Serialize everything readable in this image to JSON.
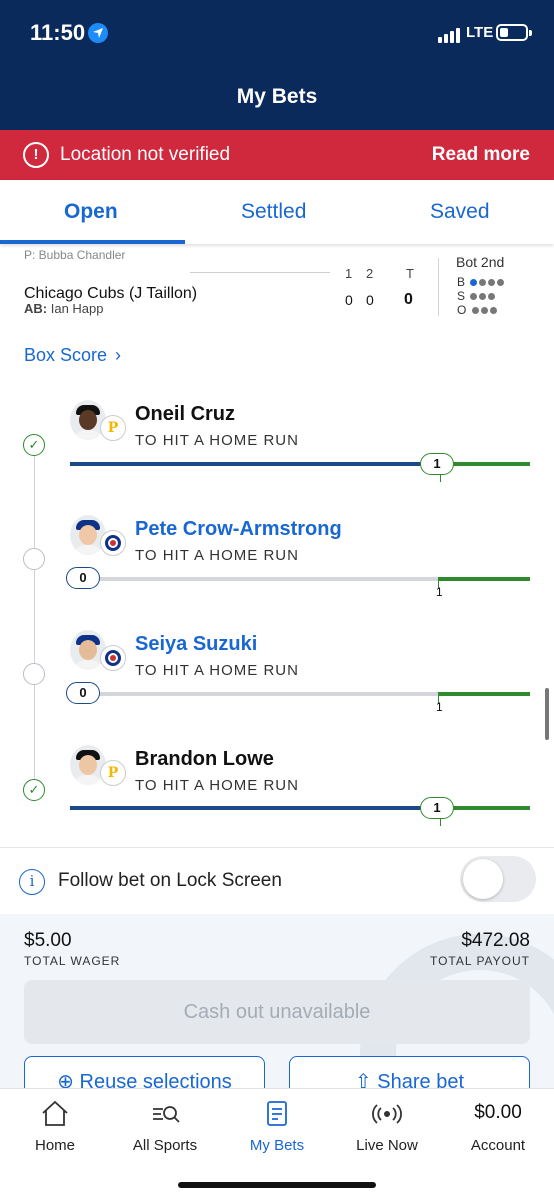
{
  "status_bar": {
    "time": "11:50",
    "network": "LTE"
  },
  "header": {
    "title": "My Bets"
  },
  "alert": {
    "message": "Location not verified",
    "action": "Read more"
  },
  "tabs": [
    {
      "label": "Open",
      "active": true
    },
    {
      "label": "Settled",
      "active": false
    },
    {
      "label": "Saved",
      "active": false
    }
  ],
  "game": {
    "cut_text": "P: Bubba Chandler",
    "innings_headers": [
      "1",
      "2",
      "T"
    ],
    "team": "Chicago Cubs (J Taillon)",
    "at_bat_label": "AB:",
    "at_bat_player": "Ian Happ",
    "scores": [
      "0",
      "0",
      "0"
    ],
    "state": "Bot 2nd",
    "count_labels": [
      "B",
      "S",
      "O"
    ],
    "count": {
      "balls": 1,
      "strikes": 0,
      "outs": 0
    }
  },
  "box_score_link": "Box Score",
  "selections": [
    {
      "player": "Oneil Cruz",
      "market": "TO HIT A HOME RUN",
      "team": "Pirates",
      "status": "won",
      "current": "1",
      "target": "1",
      "progress": 1.0
    },
    {
      "player": "Pete Crow-Armstrong",
      "market": "TO HIT A HOME RUN",
      "team": "Cubs",
      "status": "open",
      "current": "0",
      "target": "1",
      "progress": 0.0
    },
    {
      "player": "Seiya Suzuki",
      "market": "TO HIT A HOME RUN",
      "team": "Cubs",
      "status": "open",
      "current": "0",
      "target": "1",
      "progress": 0.0
    },
    {
      "player": "Brandon Lowe",
      "market": "TO HIT A HOME RUN",
      "team": "Pirates",
      "status": "won",
      "current": "1",
      "target": "1",
      "progress": 1.0
    }
  ],
  "follow": {
    "label": "Follow bet on Lock Screen",
    "enabled": false
  },
  "wager": {
    "total_wager": "$5.00",
    "total_wager_label": "TOTAL WAGER",
    "total_payout": "$472.08",
    "total_payout_label": "TOTAL PAYOUT",
    "cashout_label": "Cash out unavailable",
    "reuse_label": "Reuse selections",
    "share_label": "Share bet"
  },
  "bottom_nav": {
    "items": [
      {
        "label": "Home",
        "icon": "home-icon"
      },
      {
        "label": "All Sports",
        "icon": "sports-search-icon"
      },
      {
        "label": "My Bets",
        "icon": "bet-slip-icon",
        "active": true
      },
      {
        "label": "Live Now",
        "icon": "live-broadcast-icon"
      },
      {
        "label": "Account",
        "icon": "account-balance"
      }
    ],
    "balance": "$0.00"
  },
  "colors": {
    "header_bg": "#0a2a5c",
    "alert_bg": "#d0283d",
    "accent": "#1967d2",
    "success": "#2f8a2f",
    "progress": "#1a4a8a"
  }
}
